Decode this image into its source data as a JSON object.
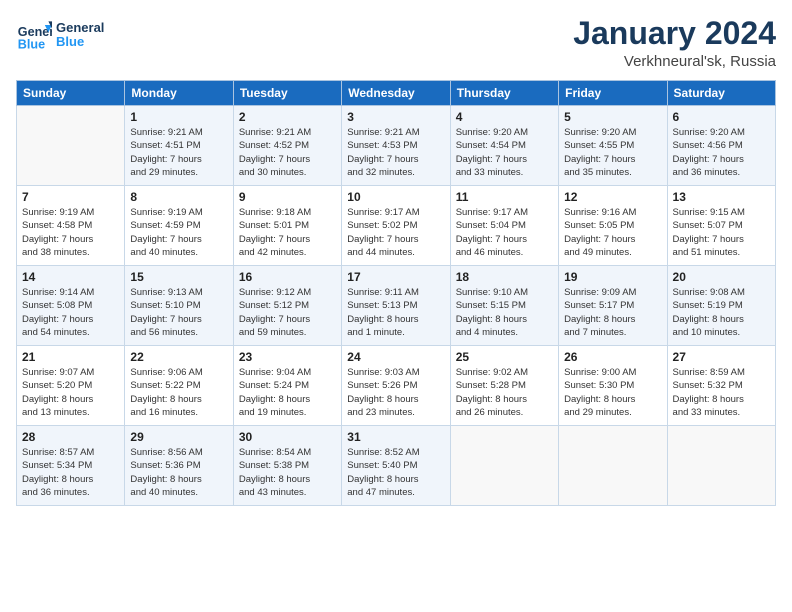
{
  "logo": {
    "line1": "General",
    "line2": "Blue"
  },
  "title": "January 2024",
  "subtitle": "Verkhneural'sk, Russia",
  "days_header": [
    "Sunday",
    "Monday",
    "Tuesday",
    "Wednesday",
    "Thursday",
    "Friday",
    "Saturday"
  ],
  "weeks": [
    [
      {
        "num": "",
        "info": ""
      },
      {
        "num": "1",
        "info": "Sunrise: 9:21 AM\nSunset: 4:51 PM\nDaylight: 7 hours\nand 29 minutes."
      },
      {
        "num": "2",
        "info": "Sunrise: 9:21 AM\nSunset: 4:52 PM\nDaylight: 7 hours\nand 30 minutes."
      },
      {
        "num": "3",
        "info": "Sunrise: 9:21 AM\nSunset: 4:53 PM\nDaylight: 7 hours\nand 32 minutes."
      },
      {
        "num": "4",
        "info": "Sunrise: 9:20 AM\nSunset: 4:54 PM\nDaylight: 7 hours\nand 33 minutes."
      },
      {
        "num": "5",
        "info": "Sunrise: 9:20 AM\nSunset: 4:55 PM\nDaylight: 7 hours\nand 35 minutes."
      },
      {
        "num": "6",
        "info": "Sunrise: 9:20 AM\nSunset: 4:56 PM\nDaylight: 7 hours\nand 36 minutes."
      }
    ],
    [
      {
        "num": "7",
        "info": "Sunrise: 9:19 AM\nSunset: 4:58 PM\nDaylight: 7 hours\nand 38 minutes."
      },
      {
        "num": "8",
        "info": "Sunrise: 9:19 AM\nSunset: 4:59 PM\nDaylight: 7 hours\nand 40 minutes."
      },
      {
        "num": "9",
        "info": "Sunrise: 9:18 AM\nSunset: 5:01 PM\nDaylight: 7 hours\nand 42 minutes."
      },
      {
        "num": "10",
        "info": "Sunrise: 9:17 AM\nSunset: 5:02 PM\nDaylight: 7 hours\nand 44 minutes."
      },
      {
        "num": "11",
        "info": "Sunrise: 9:17 AM\nSunset: 5:04 PM\nDaylight: 7 hours\nand 46 minutes."
      },
      {
        "num": "12",
        "info": "Sunrise: 9:16 AM\nSunset: 5:05 PM\nDaylight: 7 hours\nand 49 minutes."
      },
      {
        "num": "13",
        "info": "Sunrise: 9:15 AM\nSunset: 5:07 PM\nDaylight: 7 hours\nand 51 minutes."
      }
    ],
    [
      {
        "num": "14",
        "info": "Sunrise: 9:14 AM\nSunset: 5:08 PM\nDaylight: 7 hours\nand 54 minutes."
      },
      {
        "num": "15",
        "info": "Sunrise: 9:13 AM\nSunset: 5:10 PM\nDaylight: 7 hours\nand 56 minutes."
      },
      {
        "num": "16",
        "info": "Sunrise: 9:12 AM\nSunset: 5:12 PM\nDaylight: 7 hours\nand 59 minutes."
      },
      {
        "num": "17",
        "info": "Sunrise: 9:11 AM\nSunset: 5:13 PM\nDaylight: 8 hours\nand 1 minute."
      },
      {
        "num": "18",
        "info": "Sunrise: 9:10 AM\nSunset: 5:15 PM\nDaylight: 8 hours\nand 4 minutes."
      },
      {
        "num": "19",
        "info": "Sunrise: 9:09 AM\nSunset: 5:17 PM\nDaylight: 8 hours\nand 7 minutes."
      },
      {
        "num": "20",
        "info": "Sunrise: 9:08 AM\nSunset: 5:19 PM\nDaylight: 8 hours\nand 10 minutes."
      }
    ],
    [
      {
        "num": "21",
        "info": "Sunrise: 9:07 AM\nSunset: 5:20 PM\nDaylight: 8 hours\nand 13 minutes."
      },
      {
        "num": "22",
        "info": "Sunrise: 9:06 AM\nSunset: 5:22 PM\nDaylight: 8 hours\nand 16 minutes."
      },
      {
        "num": "23",
        "info": "Sunrise: 9:04 AM\nSunset: 5:24 PM\nDaylight: 8 hours\nand 19 minutes."
      },
      {
        "num": "24",
        "info": "Sunrise: 9:03 AM\nSunset: 5:26 PM\nDaylight: 8 hours\nand 23 minutes."
      },
      {
        "num": "25",
        "info": "Sunrise: 9:02 AM\nSunset: 5:28 PM\nDaylight: 8 hours\nand 26 minutes."
      },
      {
        "num": "26",
        "info": "Sunrise: 9:00 AM\nSunset: 5:30 PM\nDaylight: 8 hours\nand 29 minutes."
      },
      {
        "num": "27",
        "info": "Sunrise: 8:59 AM\nSunset: 5:32 PM\nDaylight: 8 hours\nand 33 minutes."
      }
    ],
    [
      {
        "num": "28",
        "info": "Sunrise: 8:57 AM\nSunset: 5:34 PM\nDaylight: 8 hours\nand 36 minutes."
      },
      {
        "num": "29",
        "info": "Sunrise: 8:56 AM\nSunset: 5:36 PM\nDaylight: 8 hours\nand 40 minutes."
      },
      {
        "num": "30",
        "info": "Sunrise: 8:54 AM\nSunset: 5:38 PM\nDaylight: 8 hours\nand 43 minutes."
      },
      {
        "num": "31",
        "info": "Sunrise: 8:52 AM\nSunset: 5:40 PM\nDaylight: 8 hours\nand 47 minutes."
      },
      {
        "num": "",
        "info": ""
      },
      {
        "num": "",
        "info": ""
      },
      {
        "num": "",
        "info": ""
      }
    ]
  ]
}
